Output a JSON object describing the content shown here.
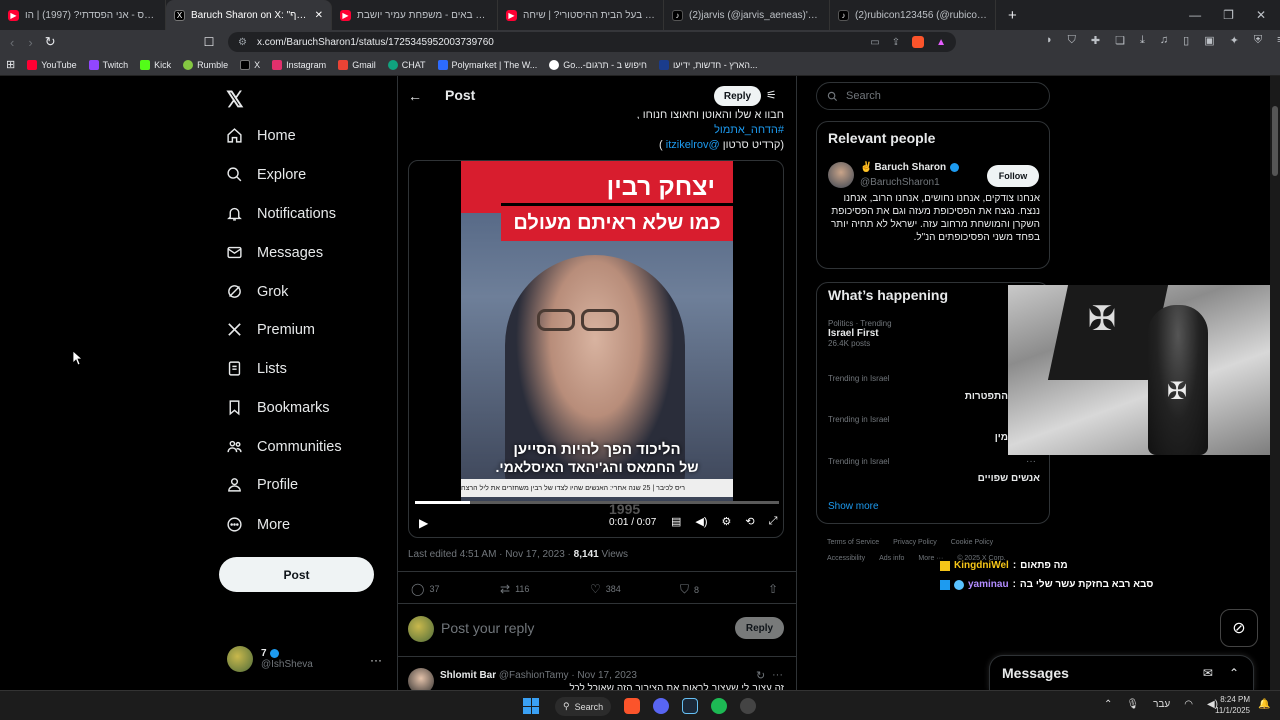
{
  "browser": {
    "tabs": [
      {
        "title": "שטעון פרס - אני הפסדתי? (1997) | הו",
        "icon": "youtube-icon"
      },
      {
        "title": "Baruch Sharon on X: \"חריף",
        "icon": "x-icon",
        "active": true
      },
      {
        "title": "היהודים באים - משפחת עמיר יושבת",
        "icon": "youtube-icon"
      },
      {
        "title": "מי פה בעל הבית ההיסטורי? | שיחה",
        "icon": "youtube-icon"
      },
      {
        "title": "(2)jarvis (@jarvis_aeneas)'s videos wi",
        "icon": "tiktok-icon"
      },
      {
        "title": "(2)rubicon123456 (@rubicon123456",
        "icon": "tiktok-icon"
      }
    ],
    "new_tab": "+",
    "url": "x.com/BaruchSharon1/status/1725345952003739760",
    "bookmarks": [
      {
        "label": "YouTube",
        "color": "#ff0033"
      },
      {
        "label": "Twitch",
        "color": "#9146ff"
      },
      {
        "label": "Kick",
        "color": "#53fc18"
      },
      {
        "label": "Rumble",
        "color": "#85c742"
      },
      {
        "label": "X",
        "color": "#000000"
      },
      {
        "label": "Instagram",
        "color": "#e1306c"
      },
      {
        "label": "Gmail",
        "color": "#ea4335"
      },
      {
        "label": "CHAT",
        "color": "#10a37f"
      },
      {
        "label": "Polymarket | The W...",
        "color": "#2d6bff"
      },
      {
        "label": "Go...-חיפוש ב - תרגום",
        "color": "#4285f4"
      },
      {
        "label": "הארץ - חדשות, ידיעו...",
        "color": "#1a3c8c"
      }
    ]
  },
  "nav": {
    "items": [
      "Home",
      "Explore",
      "Notifications",
      "Messages",
      "Grok",
      "Premium",
      "Lists",
      "Bookmarks",
      "Communities",
      "Profile",
      "More"
    ],
    "post_button": "Post",
    "account_name": "7",
    "account_handle": "@IshSheva"
  },
  "post": {
    "header": "Post",
    "reply_button": "Reply",
    "text_line1": "חבוו א שלו והאוטן וחאוצו חנוחו ,",
    "hashtag": "#הדחה_אתמול",
    "credit_prefix": "(קרדיט סרטון",
    "credit_handle": "@itzikelrov",
    "credit_suffix": ")",
    "video": {
      "title_line1": "יצחק רבין",
      "title_line2": "כמו שלא ראיתם מעולם",
      "subtitle_line1": "הליכוד הפך להיות הסייען",
      "subtitle_line2": "של החמאס והג'יהאד האיסלאמי.",
      "ticker": "ריס לכיבר | 25 שנה אחרי: האנשים שהיו לצדו של רבין משחזרים את ליל הרצח",
      "ticker_year": "1995",
      "time": "0:01 / 0:07",
      "progress": 0.15
    },
    "edited": "Last edited 4:51 AM · Nov 17, 2023",
    "views_count": "8,141",
    "views_label": "Views",
    "replies": "37",
    "reposts": "116",
    "likes": "384",
    "bookmarks": "8",
    "reply_placeholder": "Post your reply",
    "reply_submit": "Reply",
    "comment_name": "Shlomit Bar",
    "comment_handle": "@FashionTamy",
    "comment_date": "· Nov 17, 2023",
    "comment_text": "זה עצוב לי שעצוב לראות את הציבור הזה שאוכל לכל"
  },
  "right": {
    "search_placeholder": "Search",
    "relevant_title": "Relevant people",
    "person_name": "Baruch Sharon",
    "person_emoji": "✌",
    "person_handle": "@BaruchSharon1",
    "follow": "Follow",
    "bio": "אנחנו צודקים, אנחנו נחושים, אנחנו הרוב, אנחנו ננצח. נגצח את הפסיכופת מעזה וגם את הפסיכופת השקרן והמושחת מרחוב עזה. ישראל לא תחיה יותר בפחד משני הפסיכופתים הנ\"ל.",
    "happening_title": "What’s happening",
    "trends": [
      {
        "cat": "Politics · Trending",
        "name": "Israel First",
        "count": "26.4K posts"
      },
      {
        "cat": "Trending in Israel",
        "name": "התפטרות"
      },
      {
        "cat": "Trending in Israel",
        "name": "מין"
      },
      {
        "cat": "Trending in Israel",
        "name": "אנשים שפויים"
      }
    ],
    "show_more": "Show more",
    "footer1": [
      "Terms of Service",
      "Privacy Policy",
      "Cookie Policy"
    ],
    "footer2": [
      "Accessibility",
      "Ads info",
      "More ···",
      "© 2025 X Corp."
    ]
  },
  "chat": [
    {
      "user": "KingdniWel",
      "message": "מה פתאום",
      "color": "#f5c518"
    },
    {
      "user": "yaminau",
      "message": "סבא רבא בחזקת עשר שלי בה",
      "color": "#b28cff"
    }
  ],
  "messages_drawer": "Messages",
  "taskbar": {
    "search": "Search",
    "lang": "עבר",
    "time": "8:24 PM",
    "date": "11/1/2025"
  },
  "colors": {
    "accent": "#1d9bf0",
    "bg": "#000000"
  }
}
